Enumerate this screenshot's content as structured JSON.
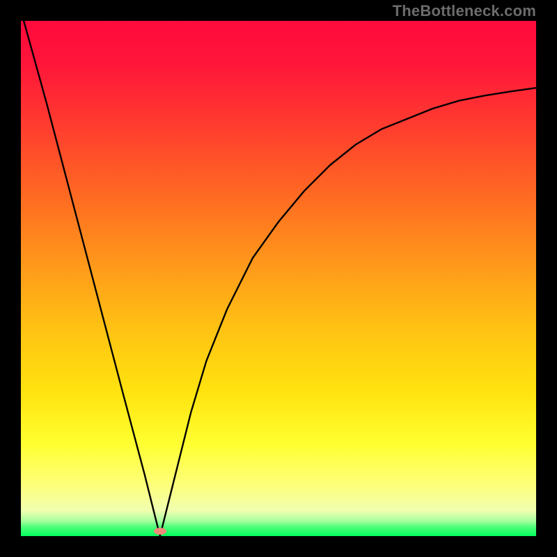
{
  "watermark": "TheBottleneck.com",
  "chart_data": {
    "type": "line",
    "title": "",
    "xlabel": "",
    "ylabel": "",
    "xlim": [
      0,
      100
    ],
    "ylim": [
      0,
      100
    ],
    "grid": false,
    "legend": false,
    "background_gradient": {
      "direction": "vertical",
      "stops": [
        {
          "pos": 0,
          "color": "#ff0a3c"
        },
        {
          "pos": 50,
          "color": "#ffb015"
        },
        {
          "pos": 82,
          "color": "#ffff30"
        },
        {
          "pos": 100,
          "color": "#03ff5b"
        }
      ]
    },
    "marker": {
      "x": 27,
      "y": 1,
      "color": "#f08a7a",
      "shape": "ellipse"
    },
    "series": [
      {
        "name": "curve",
        "color": "#000000",
        "x": [
          0,
          5,
          10,
          15,
          20,
          24,
          26,
          27,
          28,
          30,
          33,
          36,
          40,
          45,
          50,
          55,
          60,
          65,
          70,
          75,
          80,
          85,
          90,
          95,
          100
        ],
        "y": [
          102,
          84,
          65,
          46,
          27,
          12,
          4,
          0,
          4,
          12,
          24,
          34,
          44,
          54,
          61,
          67,
          72,
          76,
          79,
          81,
          83,
          84.5,
          85.5,
          86.3,
          87
        ]
      }
    ]
  }
}
